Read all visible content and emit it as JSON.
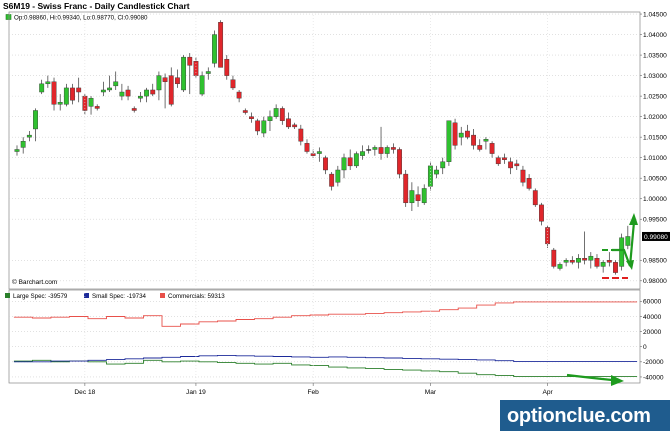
{
  "header": {
    "title": "S6M19 - Swiss Franc - Daily Candlestick Chart",
    "ohlc_label": "Op:0.98860, Hi:0.99340, Lo:0.98770, Cl:0.99080"
  },
  "credit": "© Barchart.com",
  "watermark": "optionclue.com",
  "colors": {
    "up": "#2fc12f",
    "down": "#e0262b",
    "doji": "#222222",
    "large_spec": "#2a7f2a",
    "small_spec": "#1c2a9a",
    "commercials": "#e8504a",
    "annotation_green": "#1e9b1e",
    "annotation_red": "#e02020",
    "watermark_bg": "#1f5c8e"
  },
  "chart_data": [
    {
      "type": "candlestick",
      "title": "S6M19 - Swiss Franc - Daily Candlestick Chart",
      "last_value": "0.99080",
      "ylim": [
        0.978,
        1.0455
      ],
      "y_ticks": [
        "1.04500",
        "1.04000",
        "1.03500",
        "1.03000",
        "1.02500",
        "1.02000",
        "1.01500",
        "1.01000",
        "1.00500",
        "1.00000",
        "0.99500",
        "0.99080",
        "0.98500",
        "0.98000"
      ],
      "x_ticks": [
        {
          "label": "Dec 18",
          "index": 11
        },
        {
          "label": "Jan 19",
          "index": 29
        },
        {
          "label": "Feb",
          "index": 48
        },
        {
          "label": "Mar",
          "index": 67
        },
        {
          "label": "Apr",
          "index": 86
        }
      ],
      "candles": [
        {
          "o": 1.0115,
          "h": 1.013,
          "l": 1.0105,
          "c": 1.012
        },
        {
          "o": 1.0125,
          "h": 1.015,
          "l": 1.011,
          "c": 1.014
        },
        {
          "o": 1.015,
          "h": 1.0165,
          "l": 1.014,
          "c": 1.0155
        },
        {
          "o": 1.017,
          "h": 1.022,
          "l": 1.014,
          "c": 1.0215
        },
        {
          "o": 1.026,
          "h": 1.029,
          "l": 1.0255,
          "c": 1.028
        },
        {
          "o": 1.028,
          "h": 1.03,
          "l": 1.027,
          "c": 1.0285
        },
        {
          "o": 1.0285,
          "h": 1.0295,
          "l": 1.0215,
          "c": 1.023
        },
        {
          "o": 1.023,
          "h": 1.0255,
          "l": 1.0215,
          "c": 1.0235
        },
        {
          "o": 1.023,
          "h": 1.028,
          "l": 1.0225,
          "c": 1.027
        },
        {
          "o": 1.027,
          "h": 1.028,
          "l": 1.023,
          "c": 1.024
        },
        {
          "o": 1.027,
          "h": 1.0295,
          "l": 1.0235,
          "c": 1.026
        },
        {
          "o": 1.025,
          "h": 1.0255,
          "l": 1.0205,
          "c": 1.0215
        },
        {
          "o": 1.0225,
          "h": 1.025,
          "l": 1.0205,
          "c": 1.0245
        },
        {
          "o": 1.0225,
          "h": 1.023,
          "l": 1.0215,
          "c": 1.022
        },
        {
          "o": 1.026,
          "h": 1.0285,
          "l": 1.025,
          "c": 1.0265
        },
        {
          "o": 1.0265,
          "h": 1.03,
          "l": 1.026,
          "c": 1.027
        },
        {
          "o": 1.0275,
          "h": 1.031,
          "l": 1.0265,
          "c": 1.0285
        },
        {
          "o": 1.025,
          "h": 1.028,
          "l": 1.024,
          "c": 1.026
        },
        {
          "o": 1.0265,
          "h": 1.0275,
          "l": 1.024,
          "c": 1.025
        },
        {
          "o": 1.022,
          "h": 1.0225,
          "l": 1.021,
          "c": 1.0215
        },
        {
          "o": 1.0245,
          "h": 1.026,
          "l": 1.0235,
          "c": 1.025
        },
        {
          "o": 1.025,
          "h": 1.027,
          "l": 1.0235,
          "c": 1.0265
        },
        {
          "o": 1.0265,
          "h": 1.028,
          "l": 1.025,
          "c": 1.0255
        },
        {
          "o": 1.0265,
          "h": 1.031,
          "l": 1.024,
          "c": 1.03
        },
        {
          "o": 1.0295,
          "h": 1.0305,
          "l": 1.022,
          "c": 1.0285
        },
        {
          "o": 1.03,
          "h": 1.032,
          "l": 1.0225,
          "c": 1.023
        },
        {
          "o": 1.0295,
          "h": 1.0315,
          "l": 1.027,
          "c": 1.028
        },
        {
          "o": 1.0265,
          "h": 1.035,
          "l": 1.026,
          "c": 1.0345
        },
        {
          "o": 1.0345,
          "h": 1.0355,
          "l": 1.0255,
          "c": 1.0325
        },
        {
          "o": 1.0335,
          "h": 1.0345,
          "l": 1.0295,
          "c": 1.03
        },
        {
          "o": 1.0255,
          "h": 1.031,
          "l": 1.025,
          "c": 1.03
        },
        {
          "o": 1.0305,
          "h": 1.032,
          "l": 1.029,
          "c": 1.031
        },
        {
          "o": 1.033,
          "h": 1.041,
          "l": 1.032,
          "c": 1.04
        },
        {
          "o": 1.043,
          "h": 1.0435,
          "l": 1.032,
          "c": 1.032
        },
        {
          "o": 1.034,
          "h": 1.035,
          "l": 1.029,
          "c": 1.03
        },
        {
          "o": 1.029,
          "h": 1.03,
          "l": 1.0265,
          "c": 1.027
        },
        {
          "o": 1.026,
          "h": 1.0265,
          "l": 1.0235,
          "c": 1.0245
        },
        {
          "o": 1.0215,
          "h": 1.022,
          "l": 1.0205,
          "c": 1.021
        },
        {
          "o": 1.02,
          "h": 1.021,
          "l": 1.0185,
          "c": 1.0195
        },
        {
          "o": 1.019,
          "h": 1.0195,
          "l": 1.0155,
          "c": 1.0165
        },
        {
          "o": 1.016,
          "h": 1.02,
          "l": 1.015,
          "c": 1.019
        },
        {
          "o": 1.019,
          "h": 1.0215,
          "l": 1.0165,
          "c": 1.02
        },
        {
          "o": 1.02,
          "h": 1.023,
          "l": 1.0195,
          "c": 1.022
        },
        {
          "o": 1.022,
          "h": 1.0225,
          "l": 1.018,
          "c": 1.019
        },
        {
          "o": 1.0195,
          "h": 1.021,
          "l": 1.017,
          "c": 1.0175
        },
        {
          "o": 1.018,
          "h": 1.0185,
          "l": 1.017,
          "c": 1.0175
        },
        {
          "o": 1.017,
          "h": 1.018,
          "l": 1.013,
          "c": 1.014
        },
        {
          "o": 1.0135,
          "h": 1.0145,
          "l": 1.011,
          "c": 1.0115
        },
        {
          "o": 1.011,
          "h": 1.012,
          "l": 1.01,
          "c": 1.0105
        },
        {
          "o": 1.011,
          "h": 1.0125,
          "l": 1.009,
          "c": 1.0115
        },
        {
          "o": 1.01,
          "h": 1.0105,
          "l": 1.006,
          "c": 1.007
        },
        {
          "o": 1.006,
          "h": 1.0065,
          "l": 1.002,
          "c": 1.003
        },
        {
          "o": 1.004,
          "h": 1.008,
          "l": 1.003,
          "c": 1.007
        },
        {
          "o": 1.007,
          "h": 1.011,
          "l": 1.005,
          "c": 1.01
        },
        {
          "o": 1.01,
          "h": 1.012,
          "l": 1.007,
          "c": 1.008
        },
        {
          "o": 1.008,
          "h": 1.0115,
          "l": 1.0075,
          "c": 1.011
        },
        {
          "o": 1.0105,
          "h": 1.013,
          "l": 1.0095,
          "c": 1.0115
        },
        {
          "o": 1.012,
          "h": 1.013,
          "l": 1.011,
          "c": 1.012
        },
        {
          "o": 1.012,
          "h": 1.013,
          "l": 1.0105,
          "c": 1.0125
        },
        {
          "o": 1.0125,
          "h": 1.0175,
          "l": 1.0095,
          "c": 1.011
        },
        {
          "o": 1.011,
          "h": 1.013,
          "l": 1.01,
          "c": 1.0125
        },
        {
          "o": 1.0125,
          "h": 1.0135,
          "l": 1.011,
          "c": 1.012
        },
        {
          "o": 1.012,
          "h": 1.0125,
          "l": 1.005,
          "c": 1.006
        },
        {
          "o": 1.006,
          "h": 1.007,
          "l": 0.998,
          "c": 0.999
        },
        {
          "o": 0.999,
          "h": 1.004,
          "l": 0.997,
          "c": 1.002
        },
        {
          "o": 1.001,
          "h": 1.003,
          "l": 0.998,
          "c": 0.9995
        },
        {
          "o": 0.999,
          "h": 1.0035,
          "l": 0.9985,
          "c": 1.0025
        },
        {
          "o": 1.003,
          "h": 1.009,
          "l": 1.002,
          "c": 1.008
        },
        {
          "o": 1.006,
          "h": 1.008,
          "l": 1.005,
          "c": 1.007
        },
        {
          "o": 1.0075,
          "h": 1.01,
          "l": 1.006,
          "c": 1.009
        },
        {
          "o": 1.009,
          "h": 1.019,
          "l": 1.008,
          "c": 1.019
        },
        {
          "o": 1.0185,
          "h": 1.0195,
          "l": 1.012,
          "c": 1.013
        },
        {
          "o": 1.015,
          "h": 1.0175,
          "l": 1.013,
          "c": 1.016
        },
        {
          "o": 1.0165,
          "h": 1.018,
          "l": 1.0145,
          "c": 1.015
        },
        {
          "o": 1.0155,
          "h": 1.017,
          "l": 1.012,
          "c": 1.013
        },
        {
          "o": 1.013,
          "h": 1.0145,
          "l": 1.0115,
          "c": 1.012
        },
        {
          "o": 1.014,
          "h": 1.015,
          "l": 1.012,
          "c": 1.0145
        },
        {
          "o": 1.0135,
          "h": 1.014,
          "l": 1.01,
          "c": 1.011
        },
        {
          "o": 1.01,
          "h": 1.0105,
          "l": 1.008,
          "c": 1.0085
        },
        {
          "o": 1.01,
          "h": 1.011,
          "l": 1.0085,
          "c": 1.0095
        },
        {
          "o": 1.009,
          "h": 1.01,
          "l": 1.006,
          "c": 1.0075
        },
        {
          "o": 1.0085,
          "h": 1.0095,
          "l": 1.007,
          "c": 1.008
        },
        {
          "o": 1.007,
          "h": 1.008,
          "l": 1.003,
          "c": 1.004
        },
        {
          "o": 1.005,
          "h": 1.006,
          "l": 1.002,
          "c": 1.0025
        },
        {
          "o": 1.002,
          "h": 1.0025,
          "l": 0.998,
          "c": 0.9985
        },
        {
          "o": 0.9985,
          "h": 0.999,
          "l": 0.9935,
          "c": 0.9945
        },
        {
          "o": 0.993,
          "h": 0.9935,
          "l": 0.988,
          "c": 0.989
        },
        {
          "o": 0.9875,
          "h": 0.988,
          "l": 0.983,
          "c": 0.9835
        },
        {
          "o": 0.983,
          "h": 0.9845,
          "l": 0.9825,
          "c": 0.984
        },
        {
          "o": 0.9845,
          "h": 0.9855,
          "l": 0.9835,
          "c": 0.985
        },
        {
          "o": 0.985,
          "h": 0.986,
          "l": 0.984,
          "c": 0.9845
        },
        {
          "o": 0.9845,
          "h": 0.9865,
          "l": 0.983,
          "c": 0.9855
        },
        {
          "o": 0.9855,
          "h": 0.992,
          "l": 0.984,
          "c": 0.985
        },
        {
          "o": 0.985,
          "h": 0.987,
          "l": 0.983,
          "c": 0.986
        },
        {
          "o": 0.9855,
          "h": 0.9865,
          "l": 0.983,
          "c": 0.9835
        },
        {
          "o": 0.9835,
          "h": 0.985,
          "l": 0.982,
          "c": 0.9845
        },
        {
          "o": 0.985,
          "h": 0.987,
          "l": 0.9835,
          "c": 0.9845
        },
        {
          "o": 0.9845,
          "h": 0.985,
          "l": 0.9815,
          "c": 0.982
        },
        {
          "o": 0.9835,
          "h": 0.9915,
          "l": 0.9825,
          "c": 0.9905
        },
        {
          "o": 0.9886,
          "h": 0.9934,
          "l": 0.9877,
          "c": 0.9908
        }
      ]
    },
    {
      "type": "line",
      "title": "",
      "ylim": [
        -48000,
        75000
      ],
      "y_ticks": [
        60000,
        40000,
        20000,
        0,
        -20000,
        -40000
      ],
      "series": [
        {
          "name": "Large Spec: -39579",
          "color_key": "large_spec",
          "values": [
            -19000,
            -19000,
            -19000,
            -18000,
            -18000,
            -18000,
            -20000,
            -20000,
            -20000,
            -19000,
            -19000,
            -19000,
            -20000,
            -20000,
            -20000,
            -23000,
            -23000,
            -23000,
            -22000,
            -22000,
            -22000,
            -18000,
            -18000,
            -18000,
            -20000,
            -20000,
            -20000,
            -19000,
            -19000,
            -19000,
            -20000,
            -20000,
            -20000,
            -21000,
            -21000,
            -21000,
            -22000,
            -22000,
            -22000,
            -23000,
            -23000,
            -23000,
            -22000,
            -22000,
            -22000,
            -24000,
            -24000,
            -24000,
            -25000,
            -25000,
            -25000,
            -27000,
            -27000,
            -27000,
            -28000,
            -28000,
            -28000,
            -29000,
            -29000,
            -29000,
            -30000,
            -30000,
            -30000,
            -31000,
            -31000,
            -31000,
            -32000,
            -32000,
            -32000,
            -33000,
            -33000,
            -33000,
            -35000,
            -35000,
            -35000,
            -37000,
            -37000,
            -37000,
            -38000,
            -38000,
            -38000,
            -39579,
            -39579,
            -39579,
            -39579,
            -39579,
            -39579,
            -39579,
            -39579,
            -39579,
            -39579,
            -39579,
            -39579,
            -39579,
            -39579,
            -39579,
            -39579,
            -39579,
            -39579,
            -39579,
            -39579
          ]
        },
        {
          "name": "Small Spec: -19734",
          "color_key": "small_spec",
          "values": [
            -20000,
            -20000,
            -20000,
            -20000,
            -20000,
            -20000,
            -19000,
            -19000,
            -19000,
            -19000,
            -19000,
            -19000,
            -18000,
            -18000,
            -18000,
            -17000,
            -17000,
            -17000,
            -16000,
            -16000,
            -16000,
            -15000,
            -15000,
            -15000,
            -14000,
            -14000,
            -14000,
            -13000,
            -13000,
            -13000,
            -12000,
            -12000,
            -12000,
            -11500,
            -11500,
            -11500,
            -12000,
            -12000,
            -12000,
            -12500,
            -12500,
            -12500,
            -13000,
            -13000,
            -13000,
            -13500,
            -13500,
            -13500,
            -14000,
            -14000,
            -14000,
            -13500,
            -13500,
            -13500,
            -14000,
            -14000,
            -14000,
            -14500,
            -14500,
            -14500,
            -15000,
            -15000,
            -15000,
            -15500,
            -15500,
            -15500,
            -16000,
            -16000,
            -16000,
            -16500,
            -16500,
            -16500,
            -17000,
            -17000,
            -17000,
            -17500,
            -17500,
            -17500,
            -18500,
            -18500,
            -18500,
            -19734,
            -19734,
            -19734,
            -19734,
            -19734,
            -19734,
            -19734,
            -19734,
            -19734,
            -19734,
            -19734,
            -19734,
            -19734,
            -19734,
            -19734,
            -19734,
            -19734,
            -19734,
            -19734,
            -19734
          ]
        },
        {
          "name": "Commercials: 59313",
          "color_key": "commercials",
          "values": [
            39000,
            39000,
            39000,
            38000,
            38000,
            38000,
            39000,
            39000,
            39000,
            40000,
            40000,
            40000,
            37000,
            37000,
            37000,
            40000,
            40000,
            40000,
            38000,
            38000,
            38000,
            41000,
            41000,
            41000,
            27000,
            27000,
            27000,
            30000,
            30000,
            30000,
            33000,
            33000,
            33000,
            34000,
            34000,
            34000,
            36000,
            36000,
            36000,
            37000,
            37000,
            37000,
            39000,
            39000,
            39000,
            41000,
            41000,
            41000,
            42000,
            42000,
            42000,
            43000,
            43000,
            43000,
            43000,
            43000,
            43000,
            44000,
            44000,
            44000,
            45000,
            45000,
            45000,
            46000,
            46000,
            46000,
            47000,
            47000,
            47000,
            49000,
            49000,
            49000,
            51000,
            51000,
            51000,
            55000,
            55000,
            55000,
            58000,
            58000,
            58000,
            59313,
            59313,
            59313,
            59313,
            59313,
            59313,
            59313,
            59313,
            59313,
            59313,
            59313,
            59313,
            59313,
            59313,
            59313,
            59313,
            59313,
            59313,
            59313,
            59313
          ]
        }
      ]
    }
  ]
}
